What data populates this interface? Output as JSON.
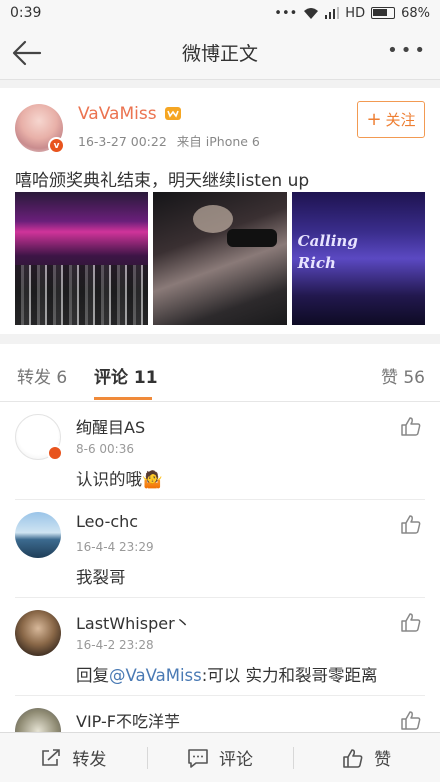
{
  "status_bar": {
    "time": "0:39",
    "dots": "•••",
    "network": "HD",
    "battery": "68%"
  },
  "nav": {
    "title": "微博正文",
    "more": "•••"
  },
  "post": {
    "username": "VaVaMiss",
    "verified_badge": "v",
    "date": "16-3-27 00:22",
    "source": "来自 iPhone 6",
    "follow_label": "关注",
    "text": "嘻哈颁奖典礼结束，明天继续listen up",
    "photo3_caption_line1": "Calling",
    "photo3_caption_line2": "Rich"
  },
  "tabs": {
    "repost": "转发 6",
    "comment": "评论 11",
    "like": "赞 56"
  },
  "comments": [
    {
      "name": "绚醒目AS",
      "time": "8-6 00:36",
      "text": "认识的哦",
      "emoji": "🤷"
    },
    {
      "name": "Leo-chc",
      "time": "16-4-4 23:29",
      "text": "我裂哥"
    },
    {
      "name": "LastWhisper丶",
      "time": "16-4-2 23:28",
      "text_prefix": "回复",
      "mention": "@VaVaMiss",
      "text_suffix": ":可以  实力和裂哥零距离"
    },
    {
      "name": "VIP-F不吃洋芋"
    }
  ],
  "bottom_bar": {
    "repost": "转发",
    "comment": "评论",
    "like": "赞"
  },
  "colors": {
    "accent_orange": "#eb7350",
    "mention_blue": "#4a7ab4",
    "tab_underline": "#f08a3a"
  }
}
